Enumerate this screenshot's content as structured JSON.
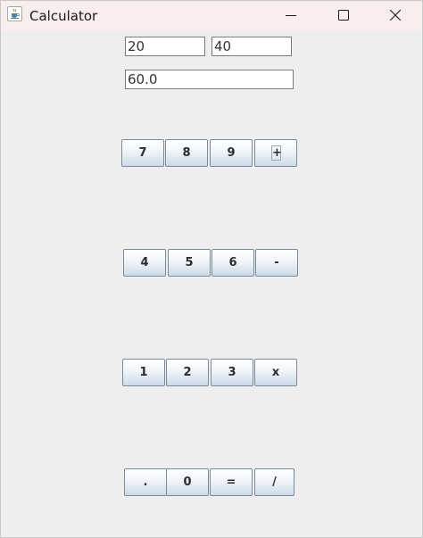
{
  "window": {
    "title": "Calculator",
    "icon": "java-cup-icon",
    "controls": [
      "minimize-icon",
      "maximize-icon",
      "close-icon"
    ]
  },
  "inputs": {
    "first_number": "20",
    "second_number": "40",
    "result": "60.0"
  },
  "keypad": {
    "row1": [
      "7",
      "8",
      "9",
      "+"
    ],
    "row2": [
      "4",
      "5",
      "6",
      "-"
    ],
    "row3": [
      "1",
      "2",
      "3",
      "x"
    ],
    "row4": [
      ".",
      "0",
      "=",
      "/"
    ]
  },
  "colors": {
    "titlebar_bg": "#f9eeeb",
    "window_bg": "#eeeeee",
    "button_gradient_top": "#ffffff",
    "button_gradient_bottom": "#cddbe8",
    "button_border": "#7a8a99"
  }
}
